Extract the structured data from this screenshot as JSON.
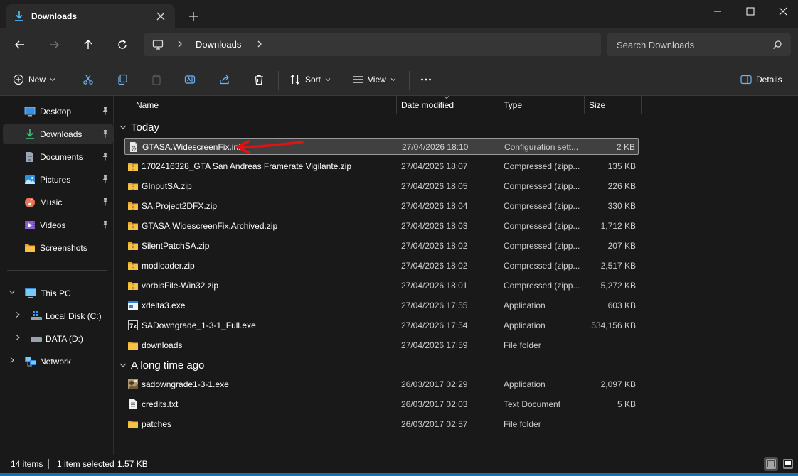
{
  "window": {
    "tab_title": "Downloads",
    "colors": {
      "accent": "#4cc2ff",
      "folder": "#f6c244",
      "annotation": "#e01212"
    }
  },
  "address": {
    "crumb": "Downloads",
    "search_placeholder": "Search Downloads"
  },
  "toolbar": {
    "new_label": "New",
    "sort_label": "Sort",
    "view_label": "View",
    "details_label": "Details"
  },
  "sidebar": {
    "quick_access": [
      {
        "label": "Desktop",
        "icon": "desktop-icon",
        "pinned": true
      },
      {
        "label": "Downloads",
        "icon": "download-icon",
        "pinned": true,
        "selected": true
      },
      {
        "label": "Documents",
        "icon": "documents-icon",
        "pinned": true
      },
      {
        "label": "Pictures",
        "icon": "pictures-icon",
        "pinned": true
      },
      {
        "label": "Music",
        "icon": "music-icon",
        "pinned": true
      },
      {
        "label": "Videos",
        "icon": "videos-icon",
        "pinned": true
      },
      {
        "label": "Screenshots",
        "icon": "folder-icon",
        "pinned": false
      }
    ],
    "this_pc": "This PC",
    "drives": [
      {
        "label": "Local Disk (C:)",
        "icon": "windows-drive-icon"
      },
      {
        "label": "DATA (D:)",
        "icon": "drive-icon"
      }
    ],
    "network": "Network"
  },
  "columns": {
    "name": "Name",
    "date": "Date modified",
    "type": "Type",
    "size": "Size"
  },
  "groups": {
    "today": "Today",
    "long_ago": "A long time ago"
  },
  "files_today": [
    {
      "name": "GTASA.WidescreenFix.ini",
      "date": "27/04/2026 18:10",
      "type": "Configuration sett...",
      "size": "2 KB",
      "icon": "config-file-icon",
      "selected": true
    },
    {
      "name": "1702416328_GTA San Andreas Framerate Vigilante.zip",
      "date": "27/04/2026 18:07",
      "type": "Compressed (zipp...",
      "size": "135 KB",
      "icon": "zip-folder-icon"
    },
    {
      "name": "GInputSA.zip",
      "date": "27/04/2026 18:05",
      "type": "Compressed (zipp...",
      "size": "226 KB",
      "icon": "zip-folder-icon"
    },
    {
      "name": "SA.Project2DFX.zip",
      "date": "27/04/2026 18:04",
      "type": "Compressed (zipp...",
      "size": "330 KB",
      "icon": "zip-folder-icon"
    },
    {
      "name": "GTASA.WidescreenFix.Archived.zip",
      "date": "27/04/2026 18:03",
      "type": "Compressed (zipp...",
      "size": "1,712 KB",
      "icon": "zip-folder-icon"
    },
    {
      "name": "SilentPatchSA.zip",
      "date": "27/04/2026 18:02",
      "type": "Compressed (zipp...",
      "size": "207 KB",
      "icon": "zip-folder-icon"
    },
    {
      "name": "modloader.zip",
      "date": "27/04/2026 18:02",
      "type": "Compressed (zipp...",
      "size": "2,517 KB",
      "icon": "zip-folder-icon"
    },
    {
      "name": "vorbisFile-Win32.zip",
      "date": "27/04/2026 18:01",
      "type": "Compressed (zipp...",
      "size": "5,272 KB",
      "icon": "zip-folder-icon"
    },
    {
      "name": "xdelta3.exe",
      "date": "27/04/2026 17:55",
      "type": "Application",
      "size": "603 KB",
      "icon": "exe-window-icon"
    },
    {
      "name": "SADowngrade_1-3-1_Full.exe",
      "date": "27/04/2026 17:54",
      "type": "Application",
      "size": "534,156 KB",
      "icon": "7zip-icon"
    },
    {
      "name": "downloads",
      "date": "27/04/2026 17:59",
      "type": "File folder",
      "size": "",
      "icon": "folder-icon"
    }
  ],
  "files_long_ago": [
    {
      "name": "sadowngrade1-3-1.exe",
      "date": "26/03/2017 02:29",
      "type": "Application",
      "size": "2,097 KB",
      "icon": "app-image-icon"
    },
    {
      "name": "credits.txt",
      "date": "26/03/2017 02:03",
      "type": "Text Document",
      "size": "5 KB",
      "icon": "text-file-icon"
    },
    {
      "name": "patches",
      "date": "26/03/2017 02:57",
      "type": "File folder",
      "size": "",
      "icon": "folder-icon"
    }
  ],
  "status": {
    "items": "14 items",
    "selected": "1 item selected",
    "selected_size": "1.57 KB"
  }
}
